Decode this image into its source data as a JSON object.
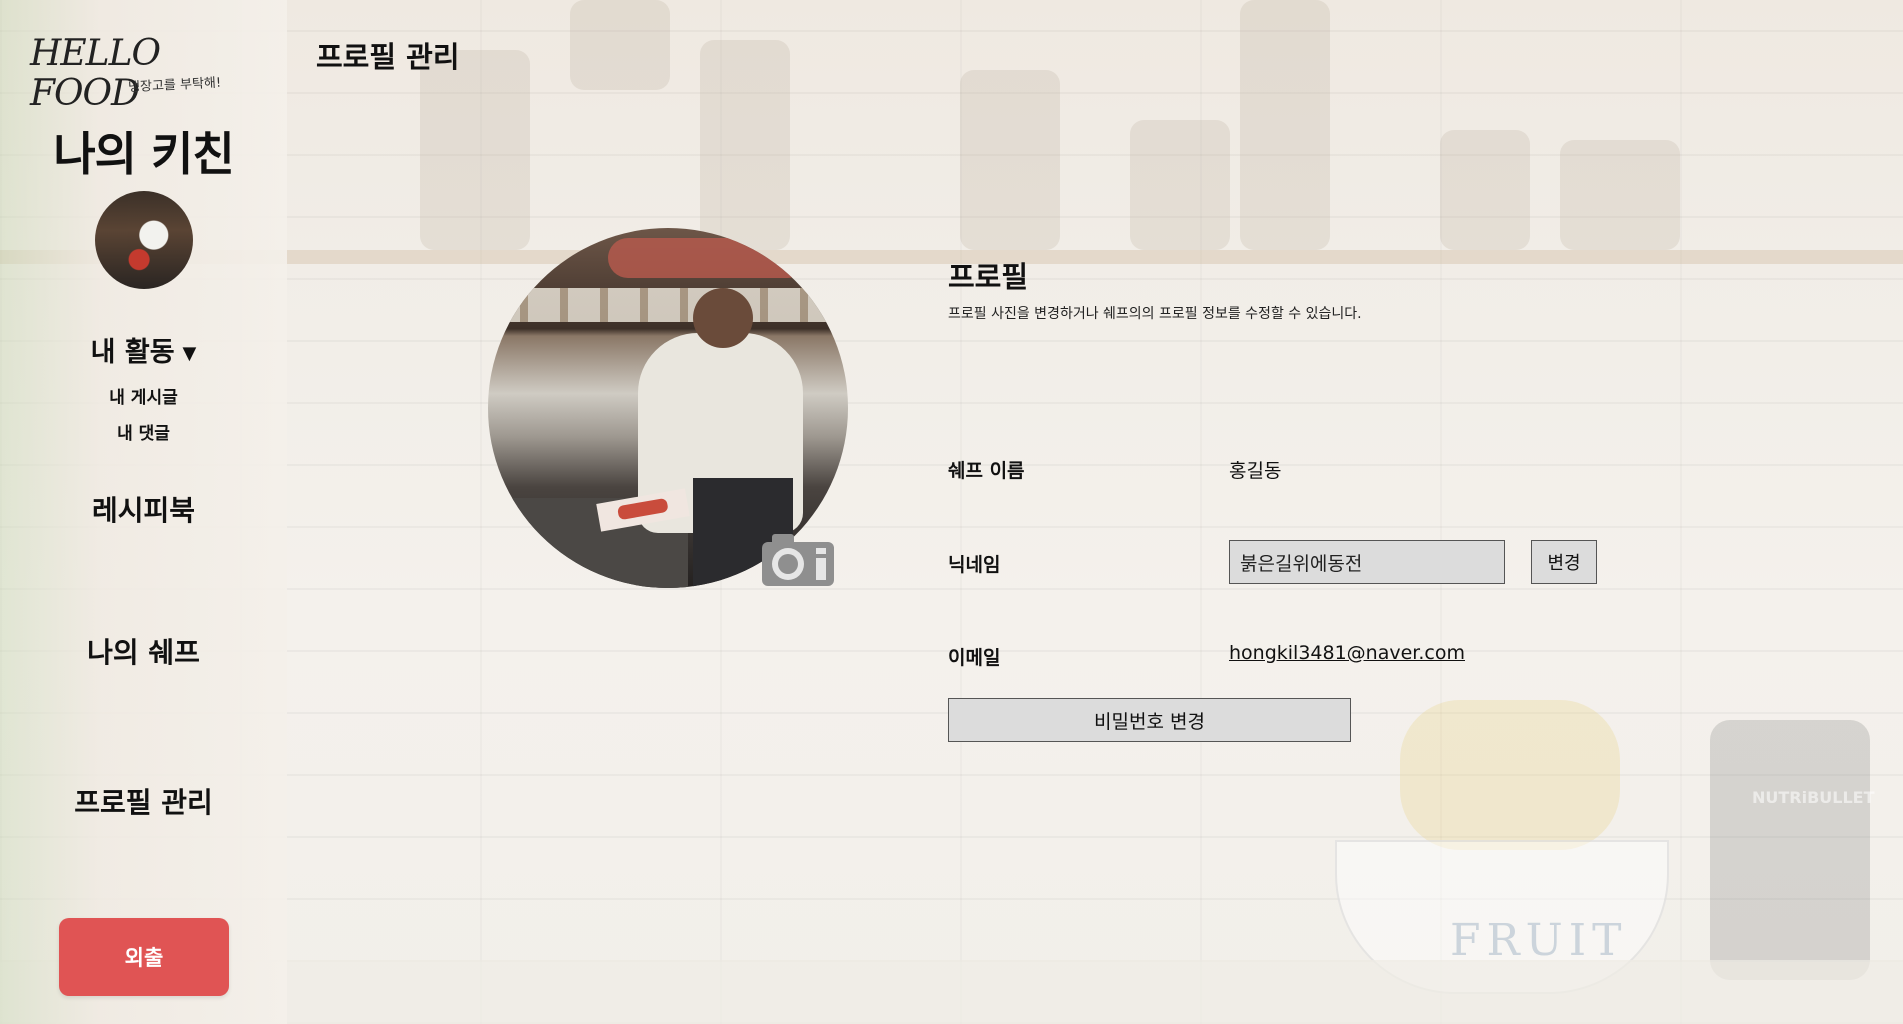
{
  "app": {
    "logo_text": "HELLO FOOD",
    "logo_tagline": "냉장고를 부탁해!"
  },
  "header": {
    "title": "프로필 관리"
  },
  "sidebar": {
    "title": "나의 키친",
    "activity_label": "내 활동",
    "activity_items": [
      "내 게시글",
      "내 댓글"
    ],
    "recipe_book": "레시피북",
    "my_chef": "나의 쉐프",
    "profile_manage": "프로필 관리",
    "logout_label": "외출"
  },
  "profile": {
    "heading": "프로필",
    "description": "프로필 사진을 변경하거나 쉐프의의 프로필 정보를 수정할 수 있습니다.",
    "chef_name_label": "쉐프 이름",
    "chef_name_value": "홍길동",
    "nickname_label": "닉네임",
    "nickname_value": "붉은길위에동전",
    "change_label": "변경",
    "email_label": "이메일",
    "email_value": "hongkil3481@naver.com",
    "password_button_label": "비밀번호 변경"
  },
  "colors": {
    "logout_button": "#e05454",
    "input_background": "#dcdcdc"
  },
  "icons": {
    "profile_upload": "camera-icon",
    "dropdown": "caret-down-icon"
  }
}
